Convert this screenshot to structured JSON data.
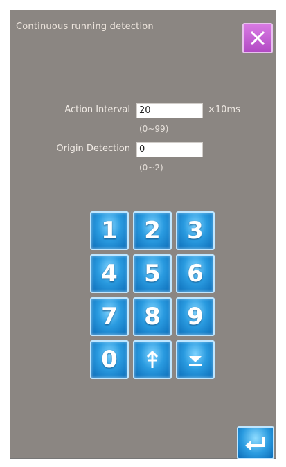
{
  "window": {
    "title": "Continuous running detection",
    "close_icon": "close-icon"
  },
  "fields": {
    "action_interval": {
      "label": "Action Interval",
      "value": "20",
      "unit": "×10ms",
      "range": "(0~99)"
    },
    "origin_detection": {
      "label": "Origin Detection",
      "value": "0",
      "range": "(0~2)"
    }
  },
  "keypad": {
    "keys": [
      "1",
      "2",
      "3",
      "4",
      "5",
      "6",
      "7",
      "8",
      "9",
      "0"
    ],
    "up_icon": "arrow-up-icon",
    "down_icon": "arrow-down-icon"
  },
  "enter_icon": "enter-icon",
  "colors": {
    "background": "#8b8682",
    "close_button": "#c25fd3",
    "key_blue": "#2a9be0"
  }
}
